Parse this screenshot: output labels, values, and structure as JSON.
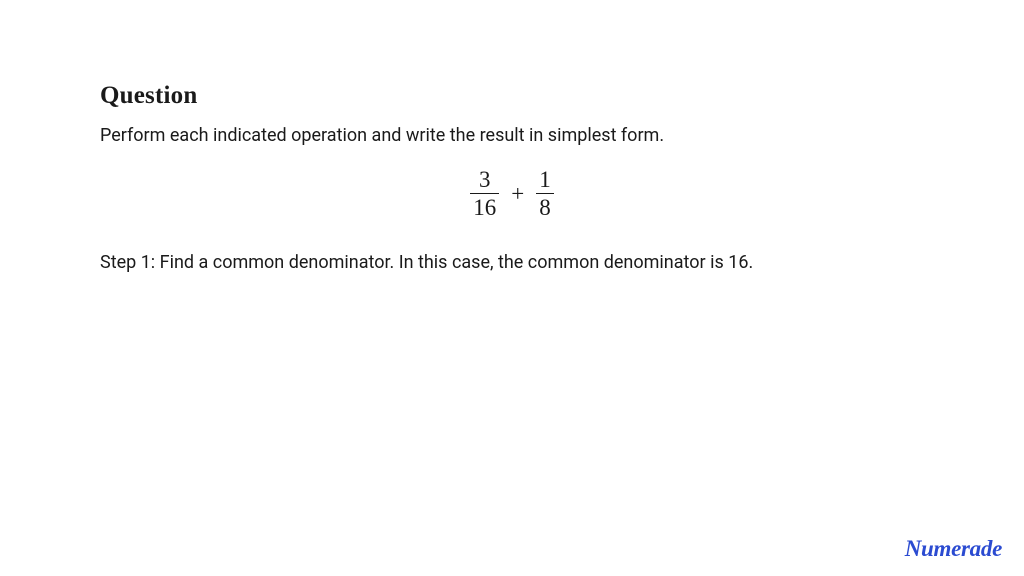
{
  "heading": "Question",
  "question_text": "Perform each indicated operation and write the result in simplest form.",
  "math": {
    "frac1_num": "3",
    "frac1_den": "16",
    "operator": "+",
    "frac2_num": "1",
    "frac2_den": "8"
  },
  "step_text": "Step 1: Find a common denominator. In this case, the common denominator is 16.",
  "brand": "Numerade"
}
